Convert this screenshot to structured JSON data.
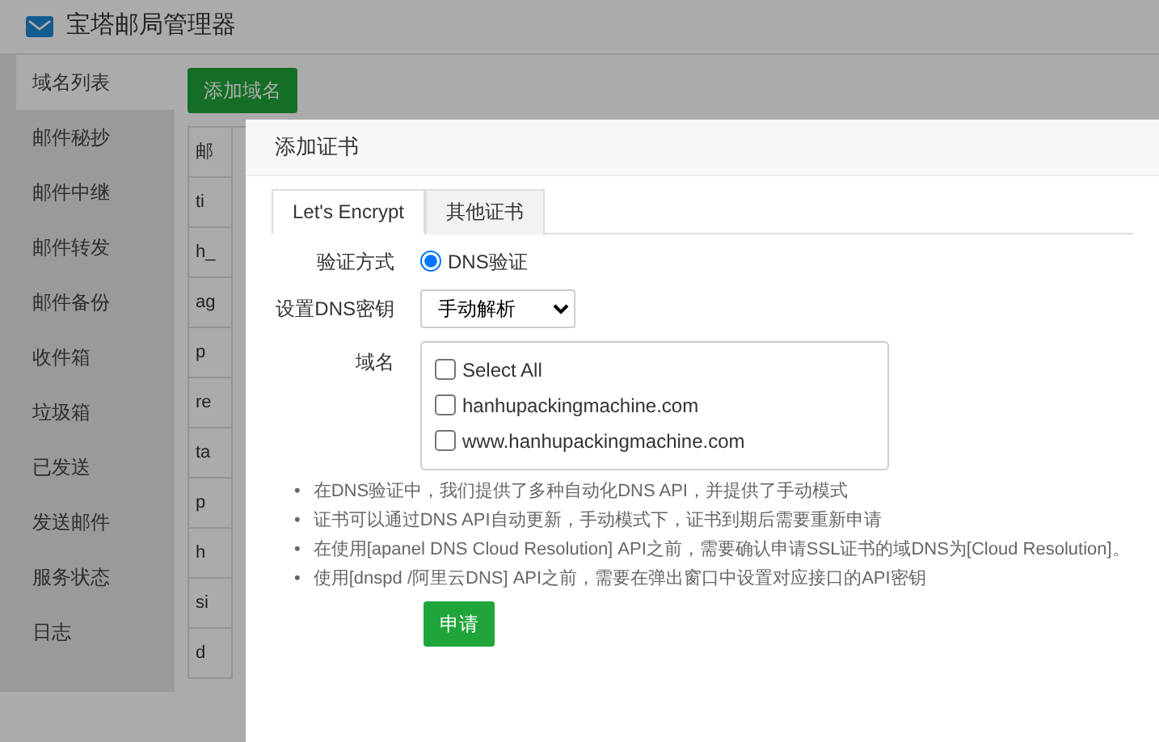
{
  "app": {
    "title": "宝塔邮局管理器"
  },
  "sidebar": {
    "items": [
      {
        "label": "域名列表",
        "selected": true
      },
      {
        "label": "邮件秘抄",
        "selected": false
      },
      {
        "label": "邮件中继",
        "selected": false
      },
      {
        "label": "邮件转发",
        "selected": false
      },
      {
        "label": "邮件备份",
        "selected": false
      },
      {
        "label": "收件箱",
        "selected": false
      },
      {
        "label": "垃圾箱",
        "selected": false
      },
      {
        "label": "已发送",
        "selected": false
      },
      {
        "label": "发送邮件",
        "selected": false
      },
      {
        "label": "服务状态",
        "selected": false
      },
      {
        "label": "日志",
        "selected": false
      }
    ]
  },
  "content": {
    "add_button": "添加域名",
    "table_cells": [
      "邮",
      "ti",
      "h_",
      "ag",
      "p",
      "re",
      "ta",
      "p",
      "h",
      "si",
      "d"
    ]
  },
  "modal": {
    "title": "添加证书",
    "tabs": [
      {
        "label": "Let's Encrypt",
        "selected": true
      },
      {
        "label": "其他证书",
        "selected": false
      }
    ],
    "verify": {
      "label": "验证方式",
      "option": "DNS验证",
      "checked": true
    },
    "dns_key": {
      "label": "设置DNS密钥",
      "value": "手动解析"
    },
    "domains": {
      "label": "域名",
      "select_all": {
        "label": "Select All",
        "checked": false
      },
      "items": [
        {
          "label": "hanhupackingmachine.com",
          "checked": false
        },
        {
          "label": "www.hanhupackingmachine.com",
          "checked": false
        }
      ]
    },
    "notes": [
      "在DNS验证中，我们提供了多种自动化DNS API，并提供了手动模式",
      "证书可以通过DNS API自动更新，手动模式下，证书到期后需要重新申请",
      "在使用[apanel DNS Cloud Resolution] API之前，需要确认申请SSL证书的域DNS为[Cloud Resolution]。",
      "使用[dnspd /阿里云DNS] API之前，需要在弹出窗口中设置对应接口的API密钥"
    ],
    "bullet": "•",
    "submit": "申请"
  }
}
